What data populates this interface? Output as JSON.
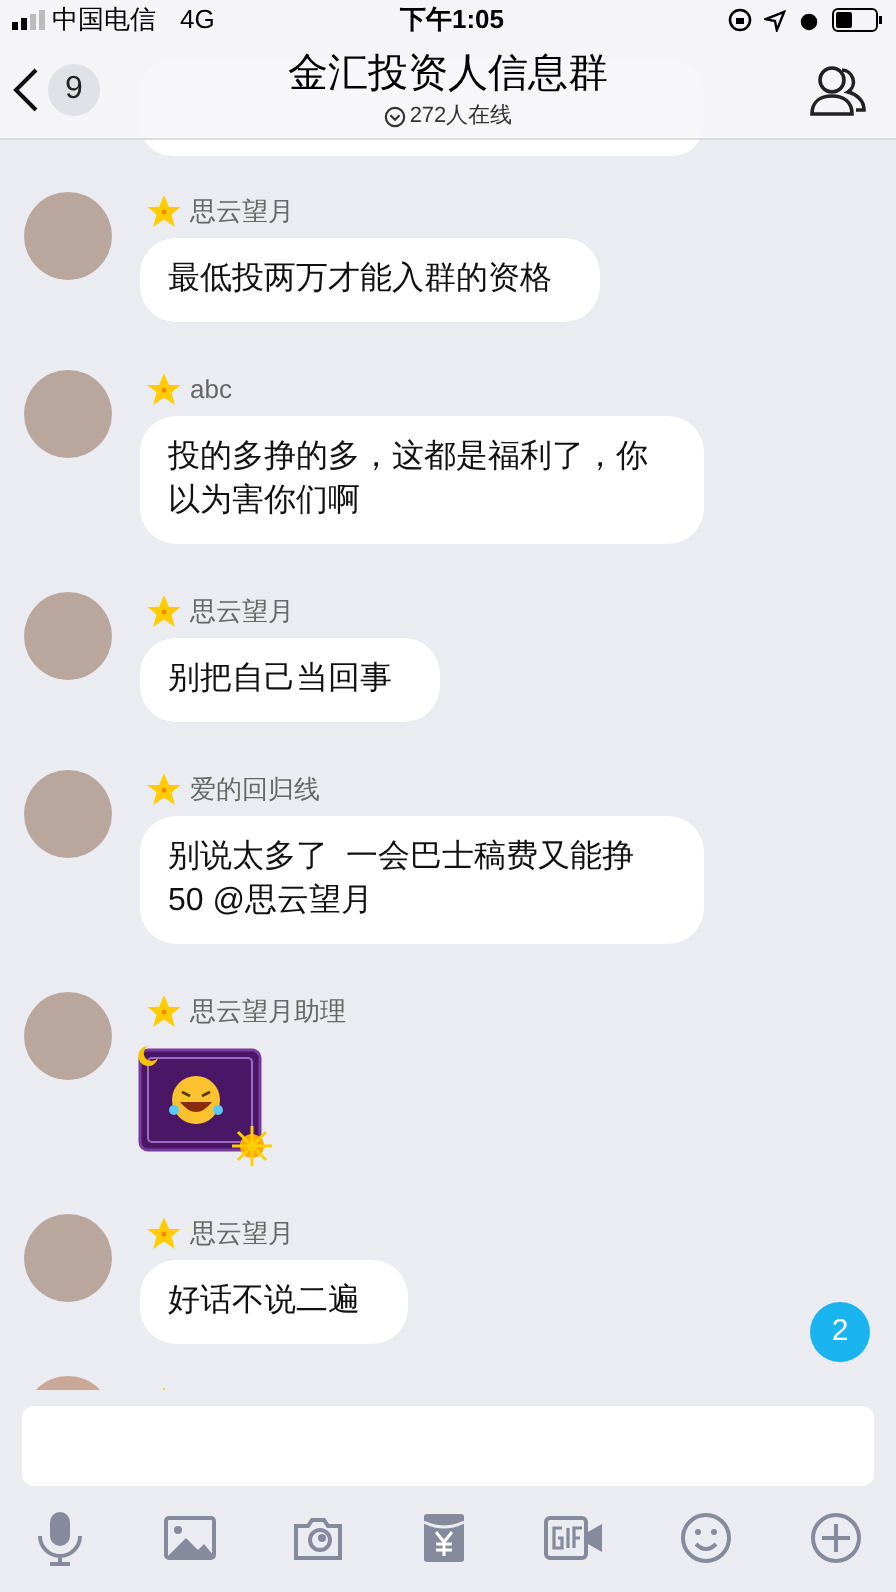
{
  "status_bar": {
    "carrier": "中国电信",
    "network": "4G",
    "time": "下午1:05"
  },
  "header": {
    "back_count": "9",
    "title": "金汇投资人信息群",
    "online": "272人在线"
  },
  "messages": [
    {
      "sender": "思云望月",
      "kind": "text",
      "text": "最低投两万才能入群的资格"
    },
    {
      "sender": "abc",
      "kind": "text",
      "text": "投的多挣的多，这都是福利了，你以为害你们啊"
    },
    {
      "sender": "思云望月",
      "kind": "text",
      "text": "别把自己当回事"
    },
    {
      "sender": "爱的回归线",
      "kind": "text",
      "text": "别说太多了  一会巴士稿费又能挣50 @思云望月"
    },
    {
      "sender": "思云望月助理",
      "kind": "sticker"
    },
    {
      "sender": "思云望月",
      "kind": "text",
      "text": "好话不说二遍"
    }
  ],
  "unread_badge": "2"
}
